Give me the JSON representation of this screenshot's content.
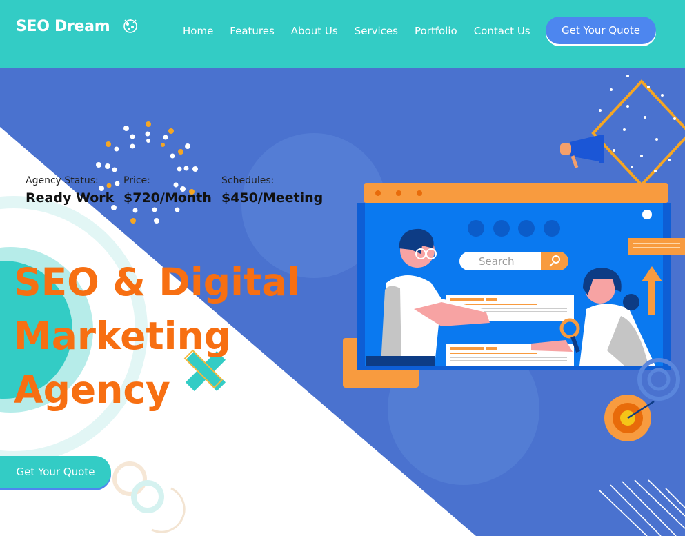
{
  "header": {
    "logo_text": "SEO Dream",
    "nav": [
      "Home",
      "Features",
      "About Us",
      "Services",
      "Portfolio",
      "Contact Us"
    ],
    "cta_label": "Get Your Quote"
  },
  "hero": {
    "info": [
      {
        "label": "Agency Status:",
        "value": "Ready Work"
      },
      {
        "label": "Price:",
        "value": "$720/Month"
      },
      {
        "label": "Schedules:",
        "value": "$450/Meeting"
      }
    ],
    "headline": [
      "SEO & Digital",
      "Marketing",
      "Agency"
    ],
    "cta_label": "Get Your Quote",
    "search_placeholder": "Search"
  },
  "colors": {
    "header_bg": "#33ccc5",
    "hero_bg": "#4a72cf",
    "accent_orange": "#f76f12",
    "button_blue": "#4d86ef",
    "teal": "#33ccc5"
  },
  "icons": [
    "logo-icon",
    "megaphone-icon",
    "search-icon",
    "magnifier-icon",
    "target-icon",
    "arrow-up-icon"
  ]
}
